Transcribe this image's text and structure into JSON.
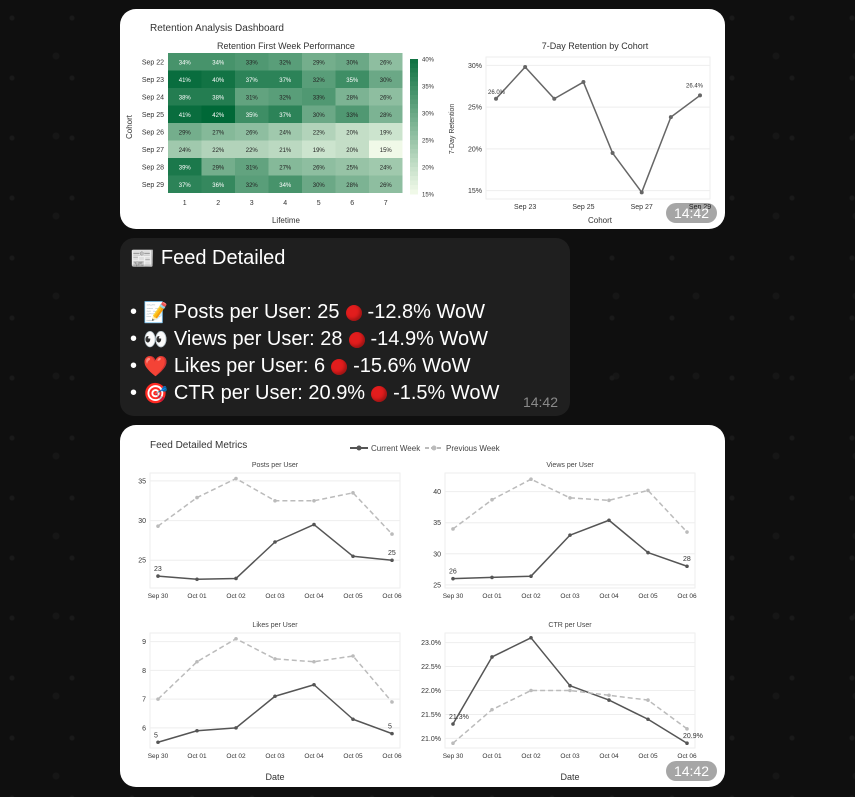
{
  "messages": [
    {
      "id": "heatmap-image",
      "time": "14:42",
      "dashboard_title": "Retention Analysis Dashboard",
      "heatmap": {
        "title": "Retention First Week Performance",
        "xlabel": "Lifetime",
        "ylabel": "Cohort",
        "rows": [
          "Sep 22",
          "Sep 23",
          "Sep 24",
          "Sep 25",
          "Sep 26",
          "Sep 27",
          "Sep 28",
          "Sep 29"
        ],
        "cols": [
          "1",
          "2",
          "3",
          "4",
          "5",
          "6",
          "7"
        ],
        "colorbar_ticks": [
          "40%",
          "35%",
          "30%",
          "25%",
          "20%",
          "15%"
        ]
      },
      "line": {
        "title": "7-Day Retention by Cohort",
        "xlabel": "Cohort",
        "ylabel": "7-Day Retention",
        "xticks": [
          "Sep 23",
          "Sep 25",
          "Sep 27",
          "Sep 29"
        ],
        "yticks": [
          "30%",
          "25%",
          "20%",
          "15%"
        ],
        "label_first": "26.0%",
        "label_last": "26.4%"
      }
    },
    {
      "id": "text-message",
      "time": "14:42",
      "title": "Feed Detailed",
      "title_icon": "newspaper-icon",
      "items": [
        {
          "icon": "📝",
          "text": "Posts per User: 25",
          "change": "-12.8% WoW"
        },
        {
          "icon": "👀",
          "text": "Views per User: 28",
          "change": "-14.9% WoW"
        },
        {
          "icon": "❤️",
          "text": "Likes per User: 6",
          "change": "-15.6% WoW"
        },
        {
          "icon": "🎯",
          "text": "CTR per User: 20.9%",
          "change": "-1.5% WoW"
        }
      ]
    },
    {
      "id": "feed-metrics-image",
      "time": "14:42",
      "title": "Feed Detailed Metrics",
      "legend": [
        "Current Week",
        "Previous Week"
      ],
      "xticks": [
        "Sep 30",
        "Oct 01",
        "Oct 02",
        "Oct 03",
        "Oct 04",
        "Oct 05",
        "Oct 06"
      ],
      "xlabel": "Date"
    }
  ],
  "chart_data": [
    {
      "type": "heatmap",
      "title": "Retention First Week Performance",
      "xlabel": "Lifetime",
      "ylabel": "Cohort",
      "x": [
        "1",
        "2",
        "3",
        "4",
        "5",
        "6",
        "7"
      ],
      "y": [
        "Sep 22",
        "Sep 23",
        "Sep 24",
        "Sep 25",
        "Sep 26",
        "Sep 27",
        "Sep 28",
        "Sep 29"
      ],
      "values": [
        [
          34,
          34,
          33,
          32,
          29,
          30,
          26
        ],
        [
          41,
          40,
          37,
          37,
          32,
          35,
          30
        ],
        [
          38,
          38,
          31,
          32,
          33,
          28,
          26
        ],
        [
          41,
          42,
          35,
          37,
          30,
          33,
          28
        ],
        [
          29,
          27,
          26,
          24,
          22,
          20,
          19
        ],
        [
          24,
          22,
          22,
          21,
          19,
          20,
          15
        ],
        [
          39,
          29,
          31,
          27,
          26,
          25,
          24
        ],
        [
          37,
          36,
          32,
          34,
          30,
          28,
          26
        ]
      ],
      "unit": "%",
      "colorbar_range": [
        15,
        40
      ]
    },
    {
      "type": "line",
      "title": "7-Day Retention by Cohort",
      "xlabel": "Cohort",
      "ylabel": "7-Day Retention",
      "x": [
        "Sep 22",
        "Sep 23",
        "Sep 24",
        "Sep 25",
        "Sep 26",
        "Sep 27",
        "Sep 28",
        "Sep 29"
      ],
      "values": [
        26.0,
        29.8,
        26.0,
        28.0,
        19.5,
        14.8,
        23.8,
        26.4
      ],
      "ylim": [
        14,
        31
      ]
    },
    {
      "type": "line",
      "title": "Posts per User",
      "x": [
        "Sep 30",
        "Oct 01",
        "Oct 02",
        "Oct 03",
        "Oct 04",
        "Oct 05",
        "Oct 06"
      ],
      "series": [
        {
          "name": "Current Week",
          "values": [
            23,
            22.6,
            22.7,
            27.3,
            29.5,
            25.5,
            25
          ]
        },
        {
          "name": "Previous Week",
          "values": [
            29.3,
            32.9,
            35.3,
            32.5,
            32.5,
            33.5,
            28.3
          ]
        }
      ],
      "ylim": [
        21.5,
        36
      ],
      "yticks": [
        25,
        30,
        35
      ],
      "labels": [
        "23",
        "25"
      ]
    },
    {
      "type": "line",
      "title": "Views per User",
      "x": [
        "Sep 30",
        "Oct 01",
        "Oct 02",
        "Oct 03",
        "Oct 04",
        "Oct 05",
        "Oct 06"
      ],
      "series": [
        {
          "name": "Current Week",
          "values": [
            26,
            26.2,
            26.4,
            33,
            35.4,
            30.2,
            28
          ]
        },
        {
          "name": "Previous Week",
          "values": [
            34,
            38.7,
            42,
            39,
            38.6,
            40.2,
            33.5
          ]
        }
      ],
      "ylim": [
        24.5,
        43
      ],
      "yticks": [
        25,
        30,
        35,
        40
      ],
      "labels": [
        "26",
        "28"
      ]
    },
    {
      "type": "line",
      "title": "Likes per User",
      "x": [
        "Sep 30",
        "Oct 01",
        "Oct 02",
        "Oct 03",
        "Oct 04",
        "Oct 05",
        "Oct 06"
      ],
      "series": [
        {
          "name": "Current Week",
          "values": [
            5.5,
            5.9,
            6,
            7.1,
            7.5,
            6.3,
            5.8
          ]
        },
        {
          "name": "Previous Week",
          "values": [
            7,
            8.3,
            9.1,
            8.4,
            8.3,
            8.5,
            6.9
          ]
        }
      ],
      "ylim": [
        5.3,
        9.3
      ],
      "yticks": [
        6,
        7,
        8,
        9
      ],
      "labels": [
        "5",
        "5"
      ]
    },
    {
      "type": "line",
      "title": "CTR per User",
      "x": [
        "Sep 30",
        "Oct 01",
        "Oct 02",
        "Oct 03",
        "Oct 04",
        "Oct 05",
        "Oct 06"
      ],
      "series": [
        {
          "name": "Current Week",
          "values": [
            21.3,
            22.7,
            23.1,
            22.1,
            21.8,
            21.4,
            20.9
          ]
        },
        {
          "name": "Previous Week",
          "values": [
            20.9,
            21.6,
            22.0,
            22.0,
            21.9,
            21.8,
            21.2
          ]
        }
      ],
      "ylim": [
        20.8,
        23.2
      ],
      "yticks": [
        "21.0%",
        "21.5%",
        "22.0%",
        "22.5%",
        "23.0%"
      ],
      "labels": [
        "21.3%",
        "20.9%"
      ]
    }
  ]
}
